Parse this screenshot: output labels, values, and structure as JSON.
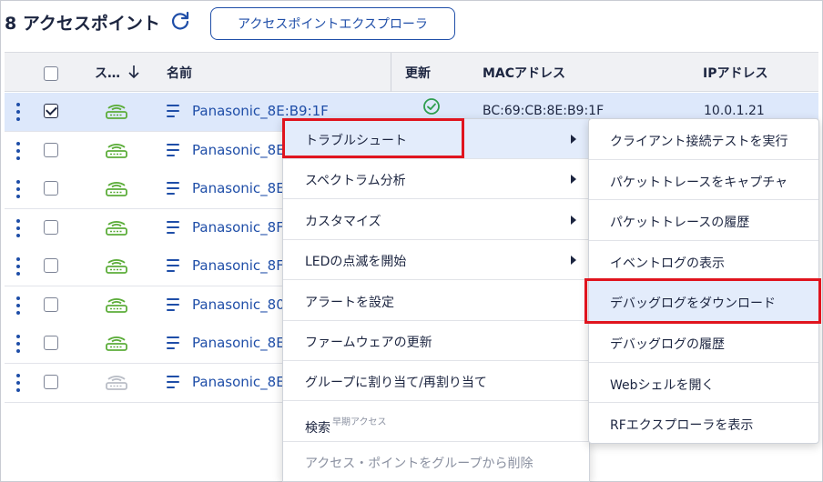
{
  "header": {
    "title": "8 アクセスポイント",
    "explorer_button": "アクセスポイントエクスプローラ"
  },
  "table": {
    "columns": {
      "status": "ス…",
      "name": "名前",
      "update": "更新",
      "mac": "MACアドレス",
      "ip": "IPアドレス"
    },
    "rows": [
      {
        "name": "Panasonic_8E:B9:1F",
        "mac": "BC:69:CB:8E:B9:1F",
        "ip": "10.0.1.21",
        "checked": true,
        "status_color": "#5cad3a"
      },
      {
        "name": "Panasonic_8E",
        "checked": false,
        "status_color": "#5cad3a"
      },
      {
        "name": "Panasonic_8E",
        "checked": false,
        "status_color": "#5cad3a"
      },
      {
        "name": "Panasonic_8F",
        "checked": false,
        "status_color": "#5cad3a"
      },
      {
        "name": "Panasonic_8F",
        "checked": false,
        "status_color": "#5cad3a"
      },
      {
        "name": "Panasonic_80",
        "checked": false,
        "status_color": "#5cad3a"
      },
      {
        "name": "Panasonic_8E",
        "checked": false,
        "status_color": "#5cad3a"
      },
      {
        "name": "Panasonic_8E",
        "checked": false,
        "status_color": "#b9bdc6"
      }
    ]
  },
  "context_menu": {
    "items": [
      {
        "label": "トラブルシュート",
        "submenu": true
      },
      {
        "label": "スペクトラム分析",
        "submenu": true
      },
      {
        "label": "カスタマイズ",
        "submenu": true
      },
      {
        "label": "LEDの点滅を開始",
        "submenu": true
      },
      {
        "label": "アラートを設定"
      },
      {
        "label": "ファームウェアの更新"
      },
      {
        "label": "グループに割り当て/再割り当て"
      },
      {
        "label": "検索",
        "badge": "早期アクセス"
      },
      {
        "label": "アクセス・ポイントをグループから削除",
        "disabled": true
      }
    ]
  },
  "submenu": {
    "items": [
      {
        "label": "クライアント接続テストを実行"
      },
      {
        "label": "パケットトレースをキャプチャ"
      },
      {
        "label": "パケットトレースの履歴"
      },
      {
        "label": "イベントログの表示"
      },
      {
        "label": "デバッグログをダウンロード"
      },
      {
        "label": "デバッグログの履歴"
      },
      {
        "label": "Webシェルを開く"
      },
      {
        "label": "RFエクスプローラを表示"
      }
    ]
  },
  "colors": {
    "accent": "#1f4ea8",
    "selected_row": "#dde8fb",
    "status_online": "#5cad3a",
    "status_offline": "#b9bdc6",
    "highlight_box": "#e0141e"
  }
}
